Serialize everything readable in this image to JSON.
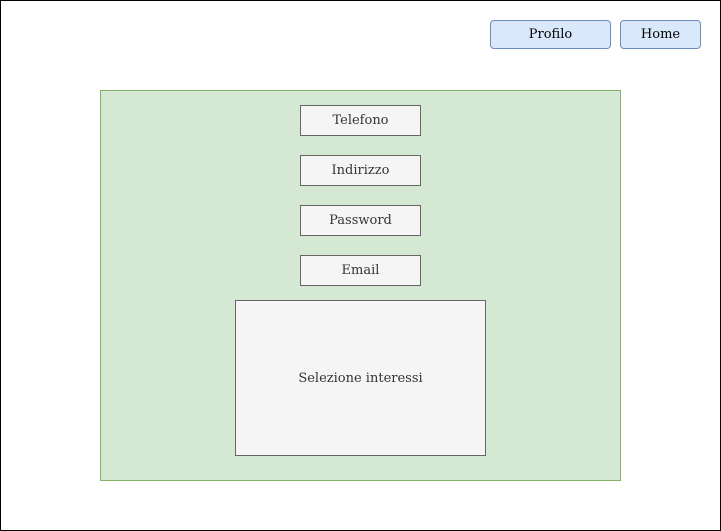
{
  "header": {
    "profile_label": "Profilo",
    "home_label": "Home"
  },
  "form": {
    "telefono_label": "Telefono",
    "indirizzo_label": "Indirizzo",
    "password_label": "Password",
    "email_label": "Email",
    "interessi_label": "Selezione interessi"
  },
  "colors": {
    "button_fill": "#dae8fc",
    "button_border": "#6c8ebf",
    "panel_fill": "#d5e8d4",
    "panel_border": "#82b366",
    "field_fill": "#f5f5f5",
    "field_border": "#666666"
  }
}
